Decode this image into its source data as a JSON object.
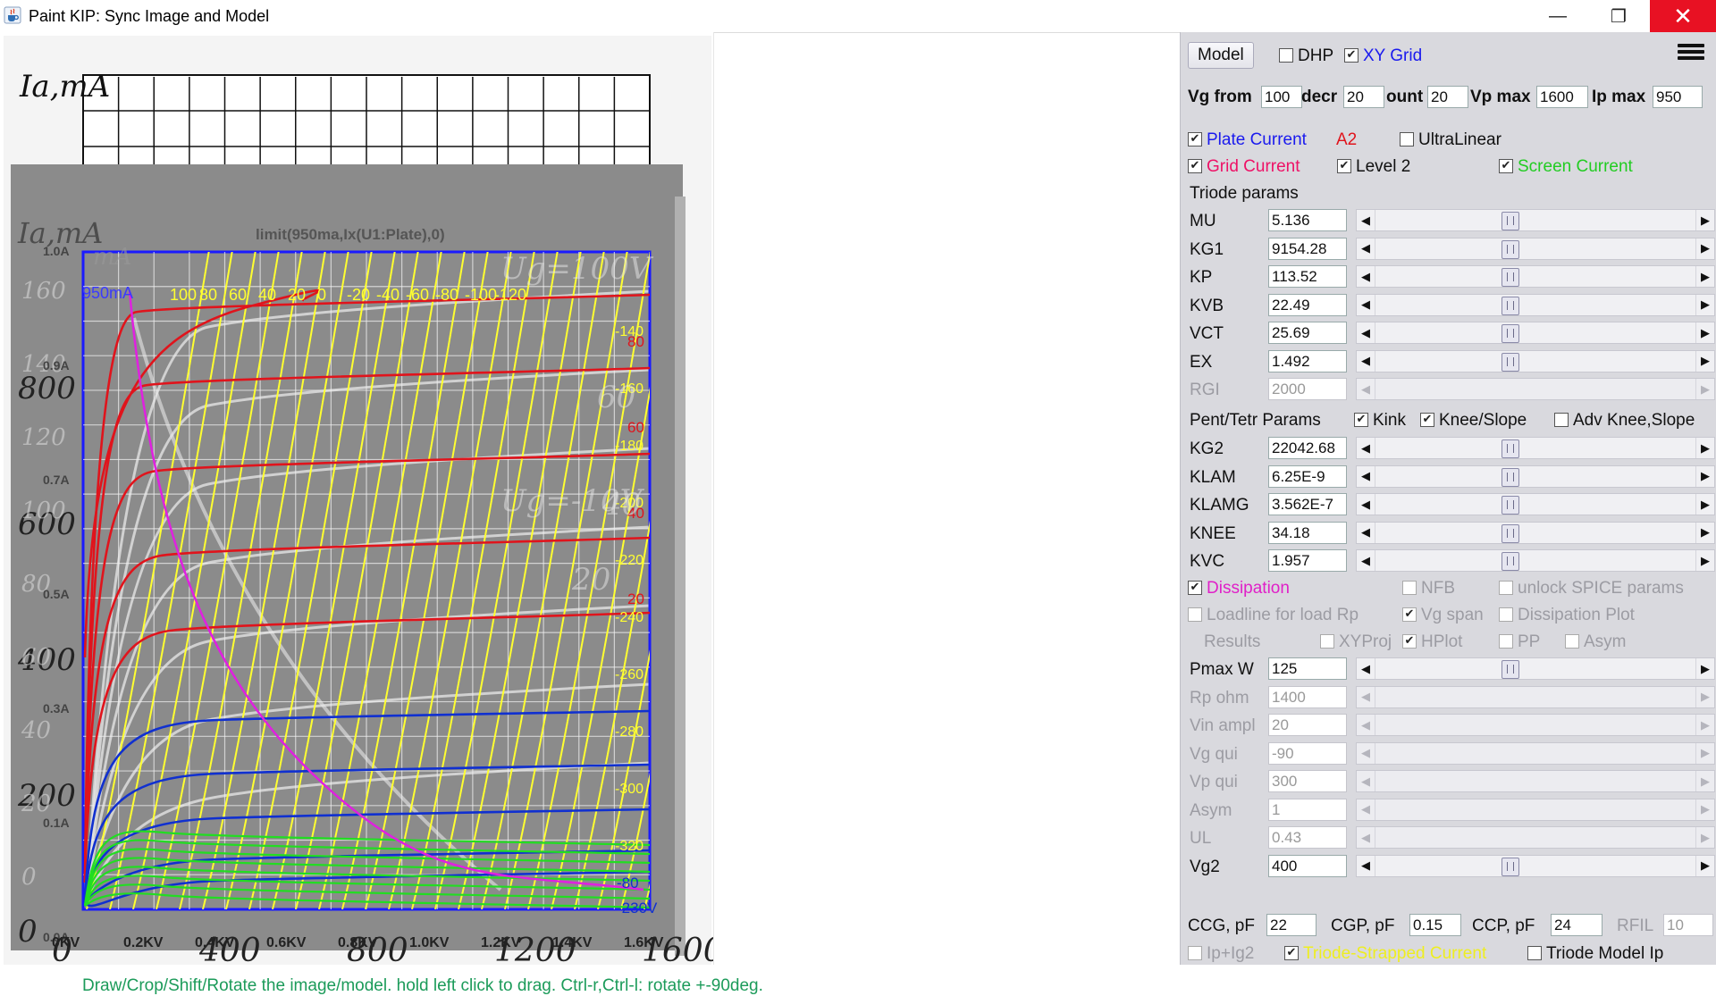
{
  "window": {
    "title": "Paint KIP: Sync Image and Model",
    "icon": "java-cup-icon",
    "controls": {
      "minimize": "—",
      "maximize": "❐",
      "close": "✕"
    }
  },
  "plot": {
    "ylabel_primary": "Ia,mA",
    "ylabel_secondary": "Ia,mA",
    "ylabel_ghost": "mA",
    "ymax_label": "950mA",
    "limit_label": "limit(950ma,Ix(U1:Plate),0)",
    "vg_labels_top": [
      "100",
      "80",
      "60",
      "40",
      "20",
      "0",
      "-20",
      "-40",
      "-60",
      "-80",
      "-100",
      "-120"
    ],
    "y_ticks_image": [
      "800",
      "600",
      "400",
      "200",
      "0"
    ],
    "y_ticks_image_secondary": [
      "160",
      "140",
      "120",
      "100",
      "80",
      "60",
      "40",
      "20",
      "0"
    ],
    "y_ticks_amps": [
      "1.0A",
      "0.9A",
      "0.7A",
      "0.5A",
      "0.3A",
      "0.1A",
      "0.0A"
    ],
    "x_ticks": [
      "0KV",
      "0.2KV",
      "0.4KV",
      "0.6KV",
      "0.8KV",
      "1.0KV",
      "1.2KV",
      "1.4KV",
      "1.6KV"
    ],
    "x_ticks_image": [
      "0",
      "400",
      "800",
      "1200",
      "1600"
    ],
    "right_labels_red": [
      "80",
      "60",
      "40",
      "20"
    ],
    "right_labels_yellow": [
      "-140",
      "-160",
      "-180",
      "-200",
      "-220",
      "-240",
      "-260",
      "-280",
      "-300",
      "-320"
    ],
    "right_labels_blue": [
      "-80",
      "-230V"
    ],
    "ghost_text": [
      "Ug=100V",
      "Ug=-10V",
      "60",
      "40",
      "20"
    ],
    "colors": {
      "plate": "#e0141c",
      "grid_curve": "#1030d0",
      "screen": "#22dd22",
      "load": "#ffff30",
      "dissipation": "#e020e0",
      "frame": "#1a1aff"
    }
  },
  "status": {
    "text": "Draw/Crop/Shift/Rotate the image/model. hold left click to drag. Ctrl-r,Ctrl-l: rotate +-90deg."
  },
  "panel": {
    "top": {
      "model_button": "Model",
      "dhp": {
        "label": "DHP",
        "checked": false
      },
      "xy_grid": {
        "label": "XY Grid",
        "checked": true
      }
    },
    "range": {
      "vg_from_label": "Vg from",
      "vg_from": "100",
      "decr_label": "decr",
      "decr": "20",
      "count_label": "ount",
      "count": "20",
      "vp_max_label": "Vp max",
      "vp_max": "1600",
      "ip_max_label": "Ip max",
      "ip_max": "950"
    },
    "options": {
      "plate_current": {
        "label": "Plate Current",
        "checked": true
      },
      "a2": "A2",
      "ultralinear": {
        "label": "UltraLinear",
        "checked": false
      },
      "grid_current": {
        "label": "Grid Current",
        "checked": true
      },
      "level2": {
        "label": "Level 2",
        "checked": true
      },
      "screen_current": {
        "label": "Screen Current",
        "checked": true
      }
    },
    "triode_title": "Triode params",
    "triode": [
      {
        "name": "MU",
        "value": "5.136"
      },
      {
        "name": "KG1",
        "value": "9154.28"
      },
      {
        "name": "KP",
        "value": "113.52"
      },
      {
        "name": "KVB",
        "value": "22.49"
      },
      {
        "name": "VCT",
        "value": "25.69"
      },
      {
        "name": "EX",
        "value": "1.492"
      },
      {
        "name": "RGI",
        "value": "2000"
      }
    ],
    "pent_title": "Pent/Tetr Params",
    "pent_opts": {
      "kink": {
        "label": "Kink",
        "checked": true
      },
      "knee_slope": {
        "label": "Knee/Slope",
        "checked": true
      },
      "adv": {
        "label": "Adv Knee,Slope",
        "checked": false
      }
    },
    "pent": [
      {
        "name": "KG2",
        "value": "22042.68"
      },
      {
        "name": "KLAM",
        "value": "6.25E-9"
      },
      {
        "name": "KLAMG",
        "value": "3.562E-7"
      },
      {
        "name": "KNEE",
        "value": "34.18"
      },
      {
        "name": "KVC",
        "value": "1.957"
      }
    ],
    "dissip_opts": {
      "dissipation": {
        "label": "Dissipation",
        "checked": true
      },
      "nfb": {
        "label": "NFB",
        "checked": false
      },
      "unlock": {
        "label": "unlock SPICE params",
        "checked": false
      },
      "loadline": {
        "label": "Loadline for load Rp",
        "checked": false
      },
      "vg_span": {
        "label": "Vg span",
        "checked": true
      },
      "dissipation_plot": {
        "label": "Dissipation Plot",
        "checked": false
      },
      "results": "Results",
      "xyproj": {
        "label": "XYProj",
        "checked": false
      },
      "hplot": {
        "label": "HPlot",
        "checked": true
      },
      "pp": {
        "label": "PP",
        "checked": false
      },
      "asym": {
        "label": "Asym",
        "checked": false
      }
    },
    "load": [
      {
        "name": "Pmax W",
        "value": "125",
        "enabled": true
      },
      {
        "name": "Rp ohm",
        "value": "1400",
        "enabled": false
      },
      {
        "name": "Vin ampl",
        "value": "20",
        "enabled": false
      },
      {
        "name": "Vg qui",
        "value": "-90",
        "enabled": false
      },
      {
        "name": "Vp qui",
        "value": "300",
        "enabled": false
      },
      {
        "name": "Asym",
        "value": "1",
        "enabled": false
      },
      {
        "name": "UL",
        "value": "0.43",
        "enabled": false
      },
      {
        "name": "Vg2",
        "value": "400",
        "enabled": true
      }
    ],
    "caps": {
      "ccg_label": "CCG, pF",
      "ccg": "22",
      "cgp_label": "CGP, pF",
      "cgp": "0.15",
      "ccp_label": "CCP, pF",
      "ccp": "24",
      "rfil_label": "RFIL",
      "rfil": "10"
    },
    "bottom_opts": {
      "ip_ig2": {
        "label": "Ip+Ig2",
        "checked": false
      },
      "triode_strapped": {
        "label": "Triode-Strapped Current",
        "checked": true
      },
      "triode_model": {
        "label": "Triode Model Ip",
        "checked": false
      }
    }
  }
}
